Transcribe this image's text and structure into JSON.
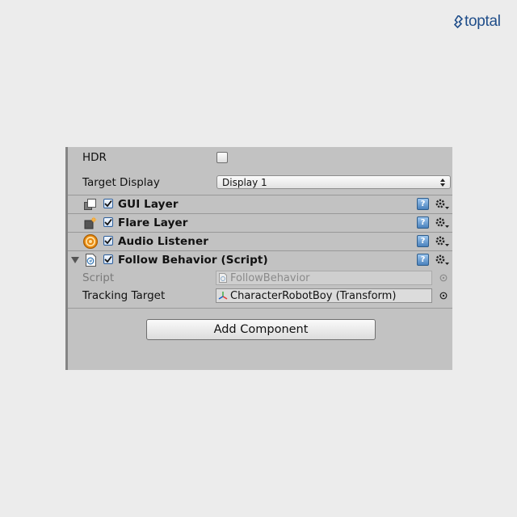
{
  "brand": {
    "name": "toptal",
    "icon": "toptal-logo-icon"
  },
  "camera": {
    "hdr_label": "HDR",
    "hdr_checked": false,
    "target_display_label": "Target Display",
    "target_display_value": "Display 1"
  },
  "components": [
    {
      "title": "GUI Layer",
      "icon": "gui-layer-icon",
      "enabled": true
    },
    {
      "title": "Flare Layer",
      "icon": "flare-layer-icon",
      "enabled": true
    },
    {
      "title": "Audio Listener",
      "icon": "audio-listener-icon",
      "enabled": true
    },
    {
      "title": "Follow Behavior (Script)",
      "icon": "csharp-script-icon",
      "enabled": true,
      "expanded": true
    }
  ],
  "script_fields": {
    "script_label": "Script",
    "script_value": "FollowBehavior",
    "tracking_label": "Tracking Target",
    "tracking_value": "CharacterRobotBoy (Transform)"
  },
  "add_component_label": "Add Component",
  "colors": {
    "panel": "#c2c2c2",
    "page": "#ececec",
    "brand": "#204e8a",
    "help_blue": "#4a82bd"
  }
}
